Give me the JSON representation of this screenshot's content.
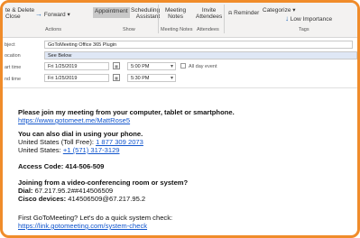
{
  "ribbon": {
    "delete_close": [
      "te & Delete",
      "Close"
    ],
    "forward": "Forward",
    "appointment": "Appointment",
    "scheduling_assistant": [
      "Scheduling",
      "Assistant"
    ],
    "meeting_notes": [
      "Meeting",
      "Notes"
    ],
    "invite_attendees": [
      "Invite",
      "Attendees"
    ],
    "reminder": "Reminder",
    "categorize": "Categorize",
    "low_importance": "Low Importance",
    "groups": {
      "actions": "Actions",
      "show": "Show",
      "meeting_notes": "Meeting Notes",
      "attendees": "Attendees",
      "tags": "Tags"
    }
  },
  "form": {
    "subject_label": "bject",
    "subject_value": "GoToMeeting Office 365 Plugin",
    "location_label": "ocation",
    "location_value": "See Below",
    "start_label": "art time",
    "start_date": "Fri 1/25/2019",
    "start_time": "5:00 PM",
    "all_day_label": "All day event",
    "end_label": "nd time",
    "end_date": "Fri 1/25/2019",
    "end_time": "5:30 PM"
  },
  "message": {
    "join_heading": "Please join my meeting from your computer, tablet or smartphone.",
    "join_link": "https://www.gotomeet.me/MattRose5",
    "dial_heading": "You can also dial in using your phone.",
    "us_tollfree_label": "United States (Toll Free): ",
    "us_tollfree_number": "1 877 309 2073",
    "us_label": "United States: ",
    "us_number": "+1 (571) 317-3129",
    "access_code": "Access Code: 414-506-509",
    "room_heading": "Joining from a video-conferencing room or system?",
    "dial_label": "Dial:",
    "dial_value": " 67.217.95.2##414506509",
    "cisco_label": "Cisco devices:",
    "cisco_value": " 414506509@67.217.95.2",
    "first_time": "First GoToMeeting? Let's do a quick system check:",
    "system_check_link": "https://link.gotomeeting.com/system-check"
  }
}
